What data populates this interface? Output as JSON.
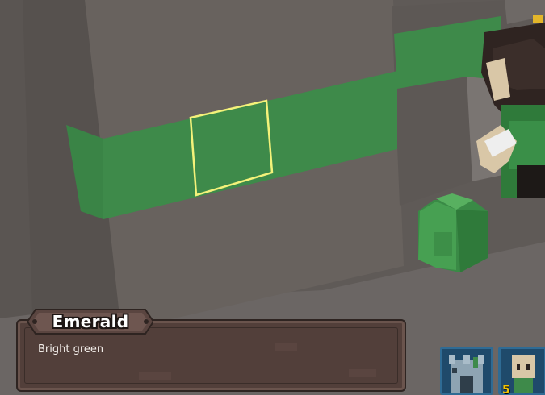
{
  "info_panel": {
    "title": "Emerald",
    "description": "Bright green"
  },
  "toolbar": {
    "slots": [
      {
        "icon": "castle-icon"
      },
      {
        "icon": "character-icon",
        "count": "5"
      }
    ]
  },
  "colors": {
    "wall": "#68625e",
    "stripe": "#3e8a4a",
    "selection": "#f4f27a",
    "panel": "#523f3a",
    "slot": "#1f4a6b"
  }
}
